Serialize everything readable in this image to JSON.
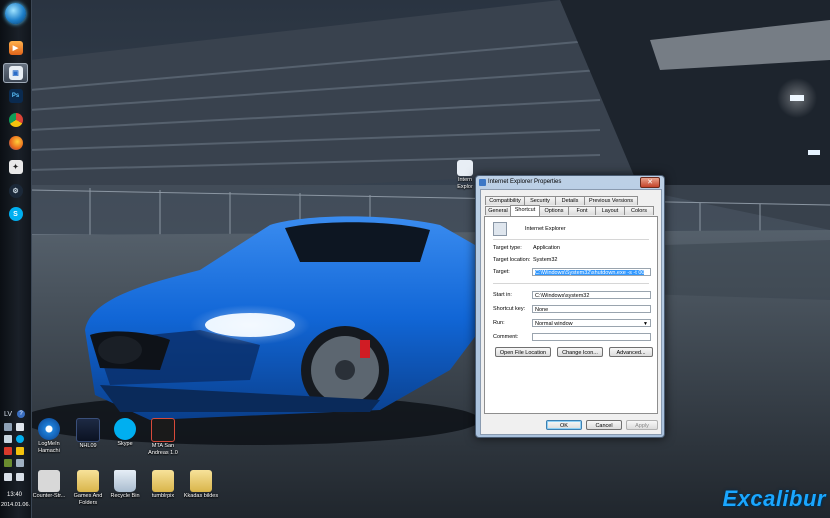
{
  "dialog": {
    "title": "Internet Explorer Properties",
    "close_glyph": "✕",
    "tabs_row1": [
      "Compatibility",
      "Security",
      "Details",
      "Previous Versions"
    ],
    "tabs_row2": [
      "General",
      "Shortcut",
      "Options",
      "Font",
      "Layout",
      "Colors"
    ],
    "selected_tab": "Shortcut",
    "shortcut_name": "Internet Explorer",
    "target_type_label": "Target type:",
    "target_type_value": "Application",
    "target_location_label": "Target location:",
    "target_location_value": "System32",
    "target_label": "Target:",
    "target_value": "C:\\Windows\\System32\\shutdown.exe -s -t 00",
    "start_in_label": "Start in:",
    "start_in_value": "C:\\Windows\\system32",
    "shortcut_key_label": "Shortcut key:",
    "shortcut_key_value": "None",
    "run_label": "Run:",
    "run_value": "Normal window",
    "comment_label": "Comment:",
    "comment_value": "",
    "open_file_location": "Open File Location",
    "change_icon": "Change Icon...",
    "advanced": "Advanced...",
    "ok": "OK",
    "cancel": "Cancel",
    "apply": "Apply"
  },
  "desktop_icons": {
    "hamachi": "LogMeIn Hamachi",
    "nhl": "NHL09",
    "skype": "Skype",
    "mta": "MTA San Andreas 1.0",
    "counter_strike": "Counter-Str...",
    "games_folders": "Games And Folders",
    "recycle_bin": "Recycle Bin",
    "tumblrpix": "tumblrpix",
    "kkadas": "Kkadas bildes",
    "ie_partial": "Intern Explor"
  },
  "tray": {
    "language": "LV",
    "time": "13:40",
    "date": "2014.01.06."
  },
  "taskbar_apps": [
    "start-orb",
    "media-player",
    "internet-explorer-shortcut",
    "photoshop",
    "chrome",
    "firefox",
    "counter-strike",
    "steam",
    "skype"
  ],
  "watermark": "Excalibur",
  "colors": {
    "car_blue": "#1166d6",
    "watermark_blue": "#1aa6ff",
    "selection_blue": "#3399ff"
  }
}
